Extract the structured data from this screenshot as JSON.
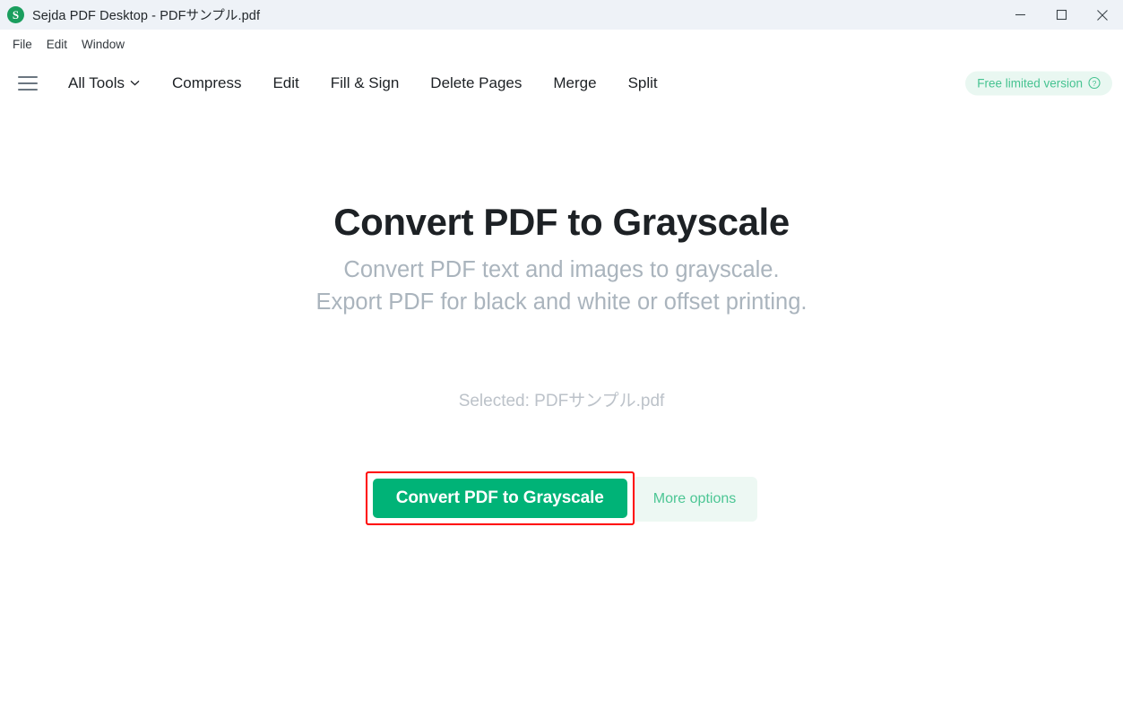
{
  "window": {
    "title": "Sejda PDF Desktop - PDFサンプル.pdf",
    "logo_letter": "S",
    "controls": {
      "minimize": "minimize-icon",
      "maximize": "maximize-icon",
      "close": "close-icon"
    }
  },
  "menubar": {
    "items": [
      {
        "label": "File"
      },
      {
        "label": "Edit"
      },
      {
        "label": "Window"
      }
    ]
  },
  "toolbar": {
    "menu_icon": "hamburger-icon",
    "items": [
      {
        "label": "All Tools",
        "chevron": "chevron-down-icon"
      },
      {
        "label": "Compress"
      },
      {
        "label": "Edit"
      },
      {
        "label": "Fill & Sign"
      },
      {
        "label": "Delete Pages"
      },
      {
        "label": "Merge"
      },
      {
        "label": "Split"
      }
    ],
    "badge": {
      "label": "Free limited version",
      "icon": "help-circle-icon"
    }
  },
  "main": {
    "title": "Convert PDF to Grayscale",
    "subtitle_line1": "Convert PDF text and images to grayscale.",
    "subtitle_line2": "Export PDF for black and white or offset printing.",
    "selected_file": "Selected: PDFサンプル.pdf",
    "primary_button": "Convert PDF to Grayscale",
    "more_options": "More options"
  },
  "colors": {
    "accent_green": "#00b377",
    "badge_green": "#46c391",
    "badge_bg": "#e9f7f1",
    "more_options_bg": "#edf8f3",
    "titlebar_bg": "#eef2f7",
    "highlight_red": "#ff0000",
    "subtitle_gray": "#aab4bd"
  }
}
